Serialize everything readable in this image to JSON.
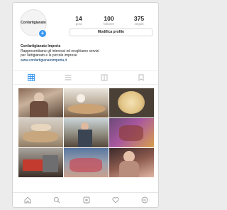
{
  "profile": {
    "avatar_text": "Confartigianato",
    "stats": [
      {
        "value": "14",
        "label": "post"
      },
      {
        "value": "100",
        "label": "follower"
      },
      {
        "value": "375",
        "label": "seguiti"
      }
    ],
    "edit_button": "Modifica profilo",
    "bio": {
      "name": "Confartigianato Imperia",
      "line1": "Rappresentiamo gli interessi ed eroghiamo servizi",
      "line2": "per l'artigianato e le piccole imprese",
      "link": "www.confartigianatoimperia.it"
    }
  },
  "tabs": [
    "grid-icon",
    "list-icon",
    "saved-icon",
    "bookmark-icon"
  ],
  "nav": [
    "home-icon",
    "search-icon",
    "add-post-icon",
    "heart-icon",
    "profile-icon"
  ],
  "colors": {
    "accent": "#3897f0",
    "link": "#003569"
  }
}
